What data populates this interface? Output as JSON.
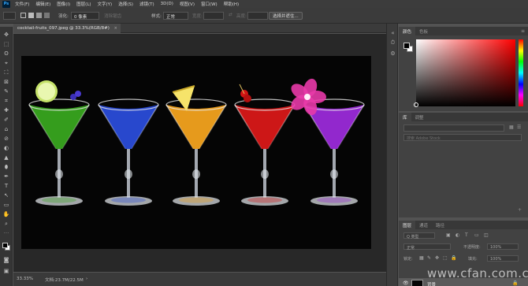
{
  "app": {
    "logo": "Ps"
  },
  "menu": [
    "文件(F)",
    "编辑(E)",
    "图像(I)",
    "图层(L)",
    "文字(Y)",
    "选择(S)",
    "滤镜(T)",
    "3D(D)",
    "视图(V)",
    "窗口(W)",
    "帮助(H)"
  ],
  "options": {
    "feather_label": "羽化:",
    "feather_value": "0 像素",
    "antialias_label": "消除锯齿",
    "style_label": "样式:",
    "style_value": "正常",
    "width_label": "宽度:",
    "height_label": "高度:",
    "select_mask_button": "选择并遮住..."
  },
  "document": {
    "tab_title": "cocktail-fruits_097.jpeg @ 33.3%(RGB/8#)",
    "close_glyph": "×"
  },
  "status": {
    "zoom": "33.33%",
    "doc_size": "文档:23.7M/22.5M",
    "arrow": "›"
  },
  "color_panel": {
    "tabs": [
      "颜色",
      "色板"
    ],
    "menu_glyph": "≡"
  },
  "libraries_panel": {
    "tabs": [
      "库",
      "调整"
    ],
    "search_placeholder": "搜索 Adobe Stock"
  },
  "layers_panel": {
    "tabs": [
      "图层",
      "通道",
      "路径"
    ],
    "filter_label": "Q 类型",
    "blend_mode": "正常",
    "opacity_label": "不透明度:",
    "opacity_value": "100%",
    "lock_label": "锁定:",
    "fill_label": "填充:",
    "fill_value": "100%",
    "layer_name": "背景",
    "visibility_glyph": "👁",
    "lock_glyph": "🔒"
  },
  "tools": [
    "✥",
    "⬚",
    "ʘ",
    "⌖",
    "⛶",
    "⊠",
    "✎",
    "⌗",
    "✚",
    "✐",
    "⌂",
    "⊘",
    "◐",
    "▲",
    "⬮",
    "✒",
    "T",
    "↖",
    "▭",
    "✋",
    "⌕"
  ],
  "cocktails": [
    {
      "name": "lime",
      "liquid": "#38a51f",
      "garnish": "lime-slice"
    },
    {
      "name": "blue",
      "liquid": "#2a4cd8",
      "garnish": "none"
    },
    {
      "name": "orange",
      "liquid": "#f2a21e",
      "garnish": "pineapple"
    },
    {
      "name": "red",
      "liquid": "#d81818",
      "garnish": "cherries"
    },
    {
      "name": "purple",
      "liquid": "#9a2ad8",
      "garnish": "hibiscus"
    }
  ],
  "watermark": "www.cfan.com.cn"
}
